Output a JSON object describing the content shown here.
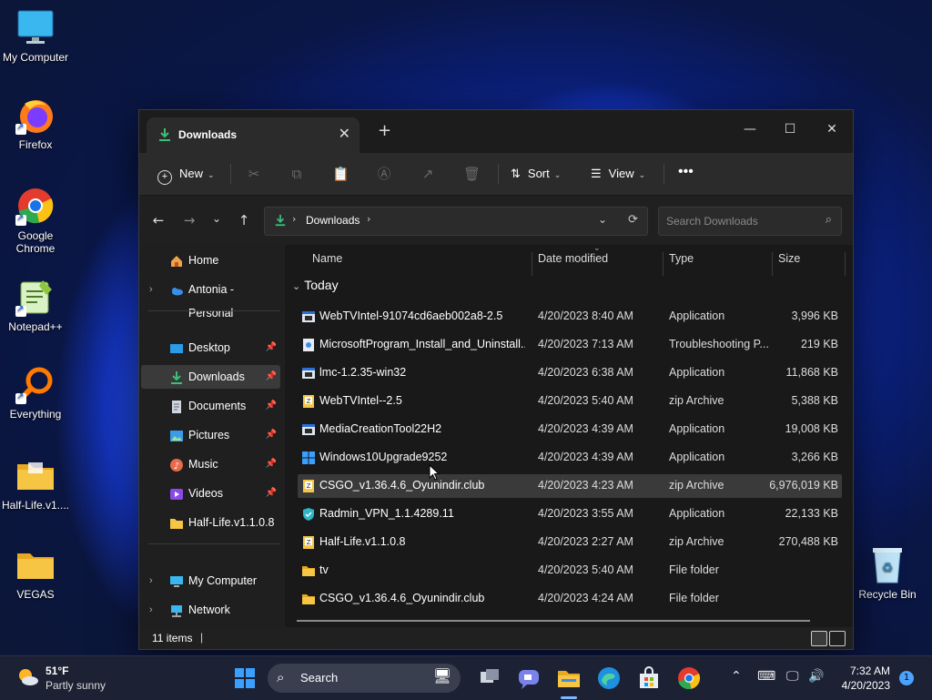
{
  "desktop": {
    "icons": [
      {
        "label": "My Computer"
      },
      {
        "label": "Firefox"
      },
      {
        "label": "Google Chrome"
      },
      {
        "label": "Notepad++"
      },
      {
        "label": "Everything"
      },
      {
        "label": "Half-Life.v1...."
      },
      {
        "label": "VEGAS"
      },
      {
        "label": "Recycle Bin"
      }
    ]
  },
  "window": {
    "tab_title": "Downloads",
    "toolbar": {
      "new_label": "New",
      "sort_label": "Sort",
      "view_label": "View"
    },
    "address": {
      "path": "Downloads",
      "search_placeholder": "Search Downloads"
    },
    "sidebar": {
      "items": [
        {
          "label": "Home"
        },
        {
          "label": "Antonia - Personal"
        },
        {
          "label": "Desktop"
        },
        {
          "label": "Downloads"
        },
        {
          "label": "Documents"
        },
        {
          "label": "Pictures"
        },
        {
          "label": "Music"
        },
        {
          "label": "Videos"
        },
        {
          "label": "Half-Life.v1.1.0.8"
        },
        {
          "label": "My Computer"
        },
        {
          "label": "Network"
        }
      ]
    },
    "columns": {
      "name": "Name",
      "date": "Date modified",
      "type": "Type",
      "size": "Size"
    },
    "group_label": "Today",
    "files": [
      {
        "name": "WebTVIntel-91074cd6aeb002a8-2.5",
        "date": "4/20/2023 8:40 AM",
        "type": "Application",
        "size": "3,996 KB",
        "icon": "app-icon"
      },
      {
        "name": "MicrosoftProgram_Install_and_Uninstall....",
        "date": "4/20/2023 7:13 AM",
        "type": "Troubleshooting P...",
        "size": "219 KB",
        "icon": "troubleshooter-icon"
      },
      {
        "name": "lmc-1.2.35-win32",
        "date": "4/20/2023 6:38 AM",
        "type": "Application",
        "size": "11,868 KB",
        "icon": "app-icon"
      },
      {
        "name": "WebTVIntel--2.5",
        "date": "4/20/2023 5:40 AM",
        "type": "zip Archive",
        "size": "5,388 KB",
        "icon": "zip-icon"
      },
      {
        "name": "MediaCreationTool22H2",
        "date": "4/20/2023 4:39 AM",
        "type": "Application",
        "size": "19,008 KB",
        "icon": "app-icon"
      },
      {
        "name": "Windows10Upgrade9252",
        "date": "4/20/2023 4:39 AM",
        "type": "Application",
        "size": "3,266 KB",
        "icon": "windows-logo-icon"
      },
      {
        "name": "CSGO_v1.36.4.6_Oyunindir.club",
        "date": "4/20/2023 4:23 AM",
        "type": "zip Archive",
        "size": "6,976,019 KB",
        "icon": "zip-icon"
      },
      {
        "name": "Radmin_VPN_1.1.4289.11",
        "date": "4/20/2023 3:55 AM",
        "type": "Application",
        "size": "22,133 KB",
        "icon": "shield-icon"
      },
      {
        "name": "Half-Life.v1.1.0.8",
        "date": "4/20/2023 2:27 AM",
        "type": "zip Archive",
        "size": "270,488 KB",
        "icon": "zip-icon"
      },
      {
        "name": "tv",
        "date": "4/20/2023 5:40 AM",
        "type": "File folder",
        "size": "",
        "icon": "folder-icon"
      },
      {
        "name": "CSGO_v1.36.4.6_Oyunindir.club",
        "date": "4/20/2023 4:24 AM",
        "type": "File folder",
        "size": "",
        "icon": "folder-icon"
      }
    ],
    "status": "11 items"
  },
  "taskbar": {
    "weather_temp": "51°F",
    "weather_desc": "Partly sunny",
    "search_label": "Search",
    "time": "7:32 AM",
    "date": "4/20/2023",
    "notification_count": "1"
  },
  "colors": {
    "accent": "#4aa3ff",
    "folder": "#f6c544",
    "download_green": "#3bbf7a"
  }
}
